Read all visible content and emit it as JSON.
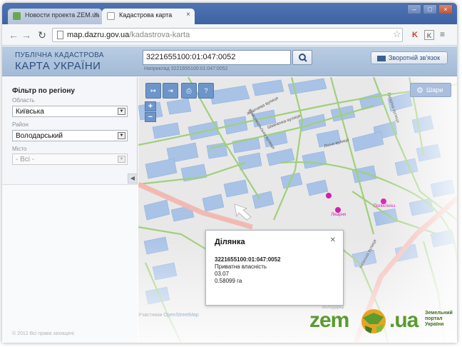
{
  "browser": {
    "tabs": [
      {
        "label": "Новости проекта ZEM.ua",
        "active": false
      },
      {
        "label": "Кадастрова карта",
        "active": true
      }
    ],
    "url_host": "map.dazru.gov.ua",
    "url_path": "/kadastrova-karta",
    "icons": {
      "back": "back-arrow-icon",
      "forward": "forward-arrow-icon",
      "reload": "reload-icon",
      "star": "star-icon",
      "menu": "hamburger-menu-icon"
    }
  },
  "header": {
    "brand_line1": "ПУБЛІЧНА КАДАСТРОВА",
    "brand_line2": "КАРТА УКРАЇНИ",
    "search_value": "3221655100:01:047:0052",
    "search_hint": "Наприклад 3221655100:01:047:0052",
    "feedback_label": "Зворотній зв'язок"
  },
  "sidebar": {
    "filter_title": "Фільтр по регіону",
    "fields": [
      {
        "label": "Область",
        "value": "Київська",
        "disabled": false
      },
      {
        "label": "Район",
        "value": "Володарський",
        "disabled": false
      },
      {
        "label": "Місто",
        "value": "- Всі -",
        "disabled": true
      }
    ],
    "copyright": "© 2012 Всі права захищені"
  },
  "map": {
    "layers_label": "Шари",
    "street_labels": [
      "Жовтнева вулиця",
      "Шевченка вулиця",
      "Лісна вулиця",
      "Комсомольська вулиця",
      "Гагаріна вулиця",
      "Київська вулиця",
      "Володарка"
    ],
    "poi_labels": [
      "Лікарня",
      "Поліклініка"
    ],
    "attribution_prefix": "Участники",
    "attribution_link": "OpenStreetMap",
    "popup": {
      "title": "Ділянка",
      "cadastral_number": "3221655100:01:047:0052",
      "ownership": "Приватна власність",
      "purpose_code": "03.07",
      "area": "0.58099 га"
    },
    "logo": {
      "zem": "zem",
      "ua": ".ua",
      "sub": [
        "Земельний",
        "портал",
        "України"
      ]
    }
  },
  "colors": {
    "accent": "#4f74b3",
    "map_bg": "#e9e9e9",
    "parcel_fill": "#a9c3e6",
    "road_green": "#9fd07a",
    "road_pink": "#f2b9b3",
    "logo_green": "#5b9b2f"
  }
}
